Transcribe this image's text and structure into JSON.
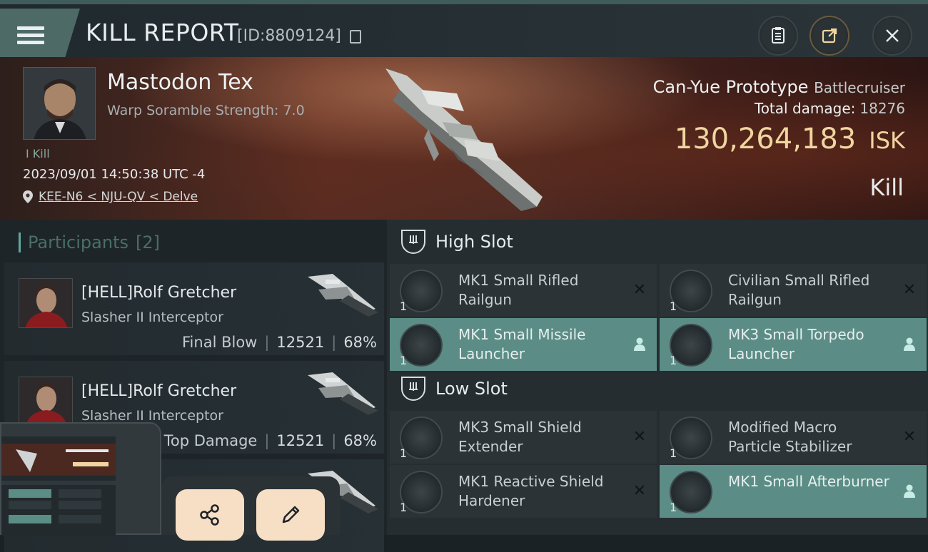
{
  "header": {
    "title": "KILL REPORT",
    "report_id": "[ID:8809124]"
  },
  "victim": {
    "name": "Mastodon Tex",
    "subtitle": "Warp Soramble Strength: 7.0",
    "kill_tag": "I Kill",
    "datetime": "2023/09/01 14:50:38 UTC -4",
    "location": "KEE-N6 < NJU-QV < Delve",
    "ship_name": "Can-Yue Prototype",
    "ship_class": "Battlecruiser",
    "total_damage_label": "Total damage:",
    "total_damage_value": "18276",
    "isk_value": "130,264,183",
    "isk_unit": "ISK",
    "result": "Kill"
  },
  "participants": {
    "title": "Participants",
    "count": "[2]",
    "list": [
      {
        "name": "[HELL]Rolf Gretcher",
        "ship": "Slasher II Interceptor",
        "label": "Final Blow",
        "damage": "12521",
        "percent": "68%"
      },
      {
        "name": "[HELL]Rolf Gretcher",
        "ship": "Slasher II Interceptor",
        "label": "Top Damage",
        "damage": "12521",
        "percent": "68%"
      }
    ]
  },
  "fitting": {
    "high_slot_title": "High Slot",
    "low_slot_title": "Low Slot",
    "high": [
      {
        "name": "MK1 Small Rifled Railgun",
        "qty": "1"
      },
      {
        "name": "Civilian Small Rifled Railgun",
        "qty": "1"
      },
      {
        "name": "MK1 Small Missile Launcher",
        "qty": "1"
      },
      {
        "name": "MK3 Small Torpedo Launcher",
        "qty": "1"
      }
    ],
    "low": [
      {
        "name": "MK3 Small Shield Extender",
        "qty": "1"
      },
      {
        "name": "Modified Macro Particle Stabilizer",
        "qty": "1"
      },
      {
        "name": "MK1 Reactive Shield Hardener",
        "qty": "1"
      },
      {
        "name": "MK1 Small Afterburner",
        "qty": "1"
      }
    ]
  },
  "colors": {
    "accent": "#5b8d86",
    "isk": "#f0d5a0",
    "fab": "#f7dfc6"
  },
  "icons": {
    "menu": "hamburger-icon",
    "clipboard": "clipboard-icon",
    "export": "export-icon",
    "close": "close-icon",
    "share": "share-icon",
    "edit": "pencil-icon"
  }
}
